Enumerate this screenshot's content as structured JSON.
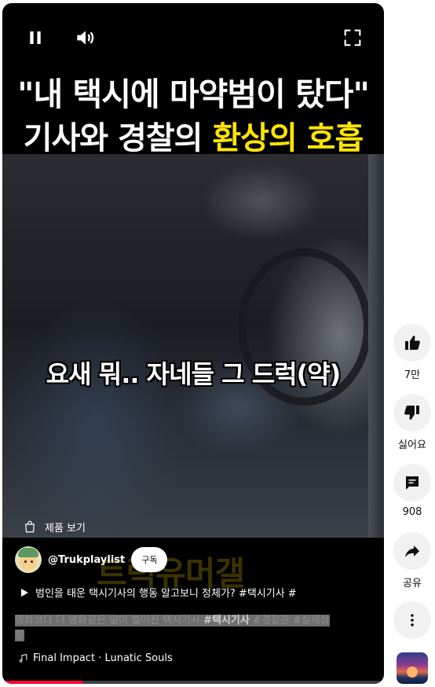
{
  "video": {
    "headline_line1": "\"내 택시에 마약범이 탔다\"",
    "headline_line2_plain": "기사와 경찰의 ",
    "headline_line2_highlight": "환상의 호흡",
    "subtitle": "요새 뭐.. 자네들 그 드럭(약)",
    "watermark": "트럭유머갤",
    "product_label": "제품 보기",
    "progress_fraction": 0.21
  },
  "controls": {
    "pause_icon": "pause-icon",
    "volume_icon": "volume-icon",
    "fullscreen_icon": "fullscreen-icon"
  },
  "channel": {
    "handle": "@Trukplaylist",
    "subscribe_label": "구독"
  },
  "title": "범인을 태운 택시기사의 행동 알고보니 정체가? #택시기사 #",
  "description": {
    "line_plain": "영화보다 더 영화같은 일이 벌어진 택시기사 ",
    "tag_bold": "#택시기사",
    "line_rest": " #경찰관 #실제상",
    "line2": "황"
  },
  "music": {
    "track": "Final Impact · Lunatic Souls"
  },
  "actions": {
    "like_count": "7만",
    "dislike_label": "싫어요",
    "comment_count": "908",
    "share_label": "공유"
  },
  "colors": {
    "accent": "#ff0033",
    "headline_highlight": "#ffe500",
    "action_bg": "#f1f1f1"
  }
}
